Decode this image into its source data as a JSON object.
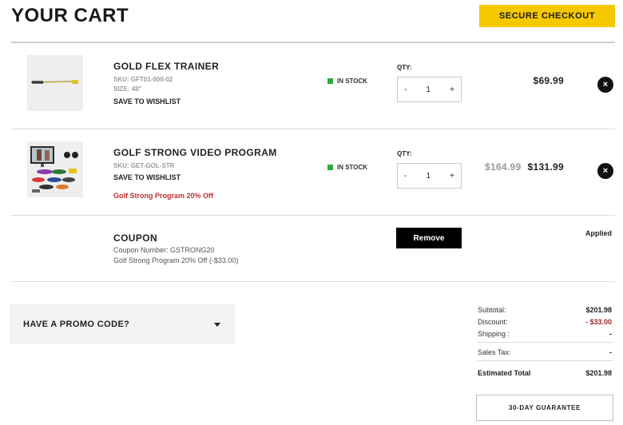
{
  "header": {
    "title": "YOUR CART",
    "checkout_label": "SECURE CHECKOUT"
  },
  "items": [
    {
      "name": "GOLD FLEX TRAINER",
      "sku": "SKU: GFT01-000-02",
      "size": "SIZE: 48\"",
      "wishlist": "SAVE TO WISHLIST",
      "stock": "IN STOCK",
      "qty_label": "QTY:",
      "qty": "1",
      "minus": "-",
      "plus": "+",
      "price": "$69.99",
      "remove_symbol": "×"
    },
    {
      "name": "GOLF STRONG VIDEO PROGRAM",
      "sku": "SKU: GET-GOL-STR",
      "wishlist": "SAVE TO WISHLIST",
      "promo_note": "Golf Strong Program 20% Off",
      "stock": "IN STOCK",
      "qty_label": "QTY:",
      "qty": "1",
      "minus": "-",
      "plus": "+",
      "old_price": "$164.99",
      "price": "$131.99",
      "remove_symbol": "×"
    }
  ],
  "coupon": {
    "title": "COUPON",
    "number": "Coupon Number: GSTRONG20",
    "description": "Golf Strong Program 20% Off (-$33.00)",
    "remove_label": "Remove",
    "status": "Applied"
  },
  "promo": {
    "label": "HAVE A PROMO CODE?"
  },
  "summary": {
    "subtotal_label": "Subtotal:",
    "subtotal": "$201.98",
    "discount_label": "Discount:",
    "discount": "- $33.00",
    "shipping_label": "Shipping :",
    "shipping": "-",
    "tax_label": "Sales Tax:",
    "tax": "-",
    "total_label": "Estimated Total",
    "total": "$201.98"
  },
  "guarantee_label": "30-DAY GUARANTEE",
  "colors": {
    "accent": "#f5c800",
    "in_stock": "#2eaa3a",
    "promo_red": "#c0302c"
  }
}
